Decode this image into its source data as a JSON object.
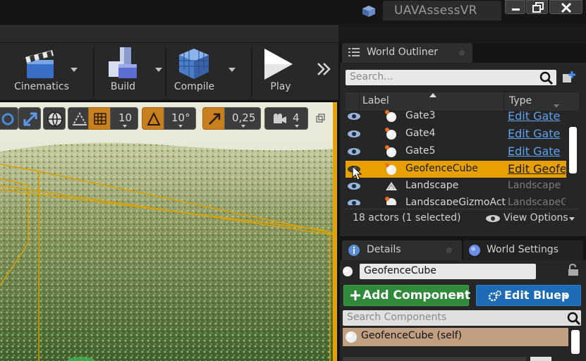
{
  "window": {
    "title": "UAVAssessVR"
  },
  "toolbar": {
    "items": [
      {
        "label": "Cinematics",
        "icon": "clapperboard-icon"
      },
      {
        "label": "Build",
        "icon": "build-blocks-icon"
      },
      {
        "label": "Compile",
        "icon": "compile-cube-icon"
      },
      {
        "label": "Play",
        "icon": "play-icon"
      }
    ]
  },
  "viewport_toolbar": {
    "grid_size": "10",
    "rotation_snap": "10°",
    "scale_snap": "0,25",
    "camera_speed": "4"
  },
  "world_outliner": {
    "tab_label": "World Outliner",
    "search_placeholder": "Search...",
    "columns": {
      "label": "Label",
      "type": "Type"
    },
    "rows": [
      {
        "label": "Gate3",
        "type": "Edit Gate",
        "type_is_link": true,
        "selected": false
      },
      {
        "label": "Gate4",
        "type": "Edit Gate",
        "type_is_link": true,
        "selected": false
      },
      {
        "label": "Gate5",
        "type": "Edit Gate",
        "type_is_link": true,
        "selected": false
      },
      {
        "label": "GeofenceCube",
        "type": "Edit Geofe",
        "type_is_link": true,
        "selected": true
      },
      {
        "label": "Landscape",
        "type": "Landscape",
        "type_is_link": false,
        "selected": false
      },
      {
        "label": "LandscapeGizmoActi",
        "type": "LandscapeG",
        "type_is_link": false,
        "selected": false
      }
    ],
    "status": "18 actors (1 selected)",
    "view_options": "View Options"
  },
  "details": {
    "tab_label": "Details",
    "world_settings_tab": "World Settings",
    "object_name": "GeofenceCube",
    "add_component": "Add Component",
    "edit_blueprint": "Edit Bluep",
    "search_components_placeholder": "Search Components",
    "component_self": "GeofenceCube (self)"
  },
  "colors": {
    "selection": "#e6a000",
    "link": "#5da3f0",
    "add_component": "#2f8a3a",
    "edit_blueprint": "#1e6bb6"
  }
}
